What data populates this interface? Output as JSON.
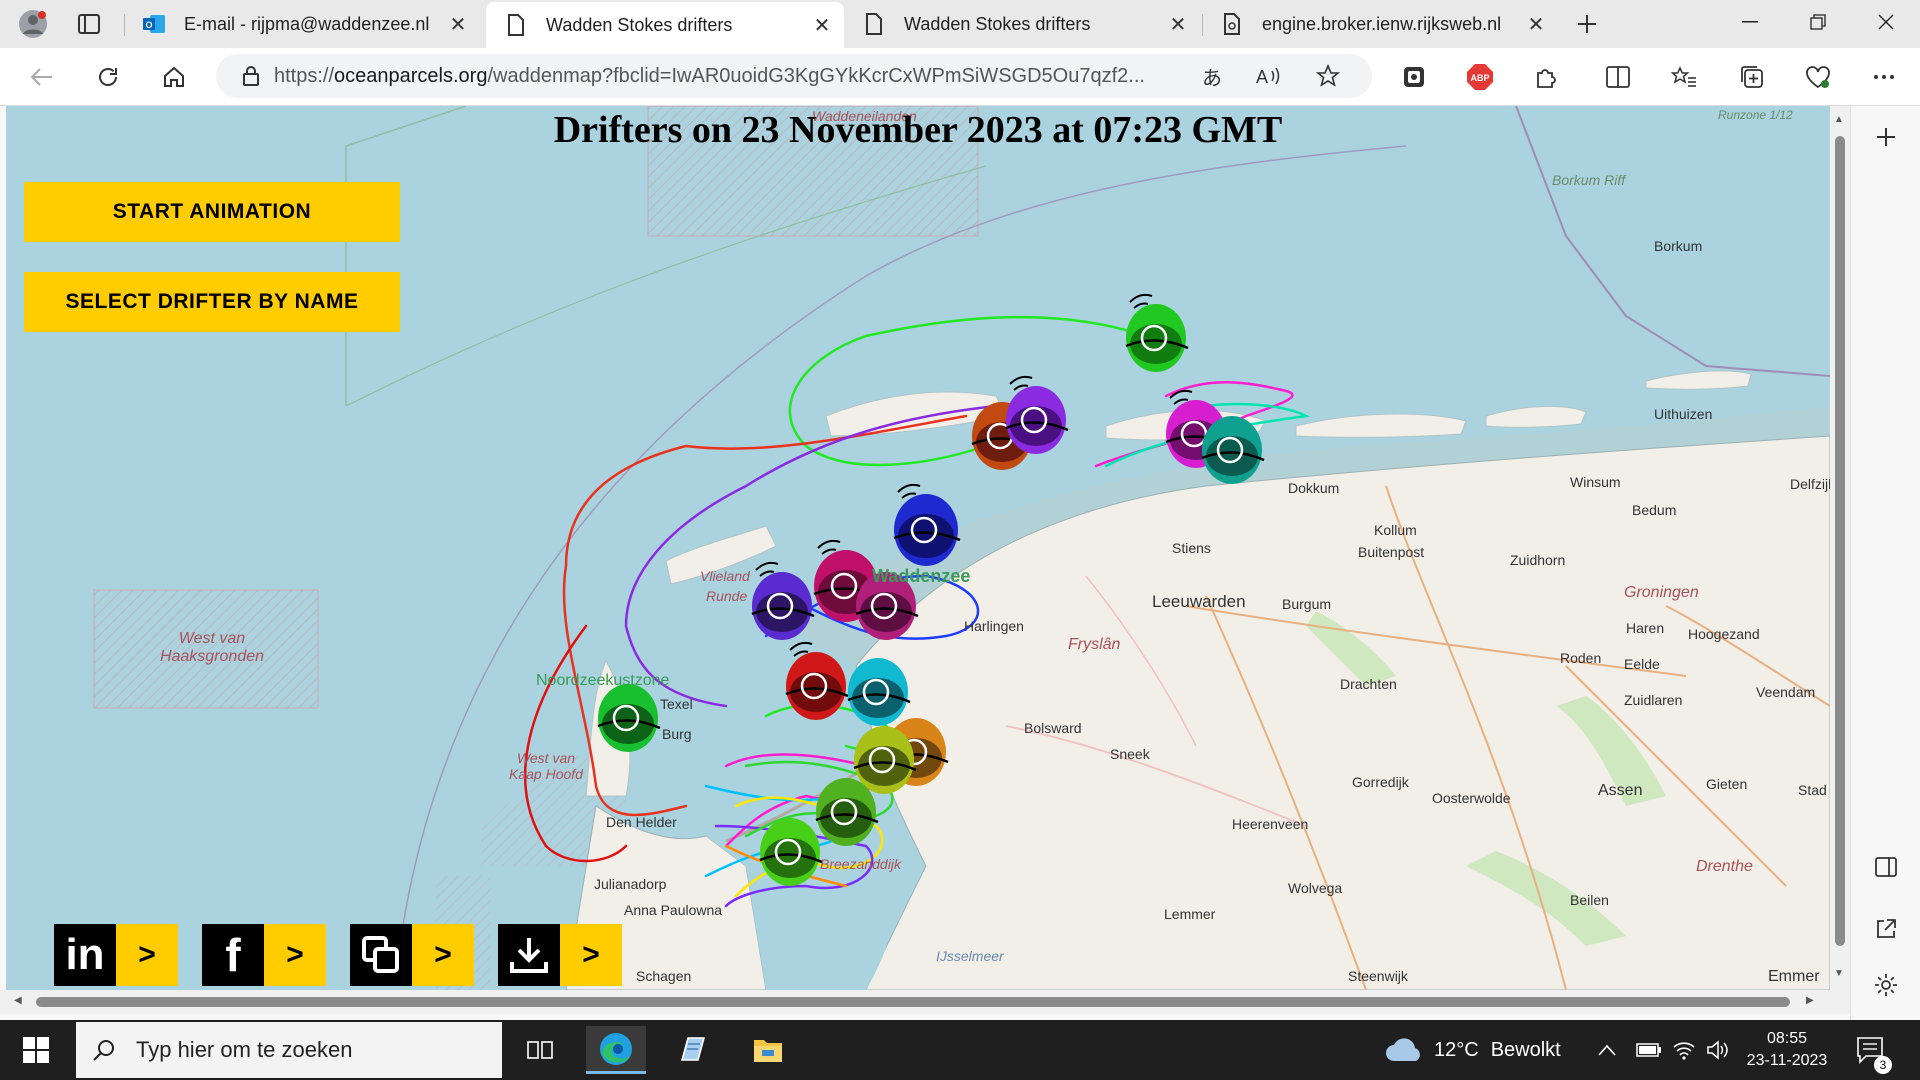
{
  "browser": {
    "tabs": [
      {
        "title": "E-mail - rijpma@waddenzee.nl",
        "active": false,
        "favicon": "outlook-icon"
      },
      {
        "title": "Wadden Stokes drifters",
        "active": true,
        "favicon": "page-icon"
      },
      {
        "title": "Wadden Stokes drifters",
        "active": false,
        "favicon": "page-icon"
      },
      {
        "title": "engine.broker.ienw.rijksweb.nl",
        "active": false,
        "favicon": "document-icon"
      }
    ],
    "url_prefix": "https://",
    "url_host": "oceanparcels.org",
    "url_path": "/waddenmap?fbclid=IwAR0uoidG3KgGYkKcrCxWPmSiWSGD5Ou7qzf2...",
    "extensions": {
      "abp": "ABP"
    }
  },
  "page": {
    "title": "Drifters on 23 November 2023 at 07:23 GMT",
    "buttons": {
      "start_animation": "START ANIMATION",
      "select_drifter": "SELECT DRIFTER BY NAME"
    },
    "share": {
      "linkedin": "in",
      "facebook": "f",
      "arrow": ">"
    }
  },
  "map": {
    "labels": [
      "Waddeneilanden",
      "Borkum Riff",
      "Borkum",
      "Uithuizen",
      "Delfzijl",
      "Winsum",
      "Bedum",
      "Dokkum",
      "Kollum",
      "Buitenpost",
      "Zuidhorn",
      "Groningen",
      "Haren",
      "Hoogezand",
      "Stiens",
      "Leeuwarden",
      "Burgum",
      "Harlingen",
      "Fryslân",
      "Drachten",
      "Roden",
      "Eelde",
      "Zuidlaren",
      "Veendam",
      "Bolsward",
      "Sneek",
      "Gorredijk",
      "Oosterwolde",
      "Assen",
      "Gieten",
      "Stad",
      "Heerenveen",
      "Wolvega",
      "Drenthe",
      "Beilen",
      "Lemmer",
      "Steenwijk",
      "Emmer",
      "IJsselmeer",
      "Texel",
      "Burg",
      "Den Helder",
      "Breezanddijk",
      "Julianadorp",
      "Anna Paulowna",
      "Schagen",
      "West van Haaksgronden",
      "West van Kaap Hoofd",
      "Noordzeekustzone",
      "Vlieland",
      "Runde",
      "Waddenzee",
      "Runzone 1/12"
    ]
  },
  "sidebar": {
    "items": [
      "add",
      "split-screen",
      "open-external",
      "settings"
    ]
  },
  "taskbar": {
    "search_placeholder": "Typ hier om te zoeken",
    "weather_temp": "12°C",
    "weather_text": "Bewolkt",
    "time": "08:55",
    "date": "23-11-2023",
    "notification_count": "3"
  }
}
